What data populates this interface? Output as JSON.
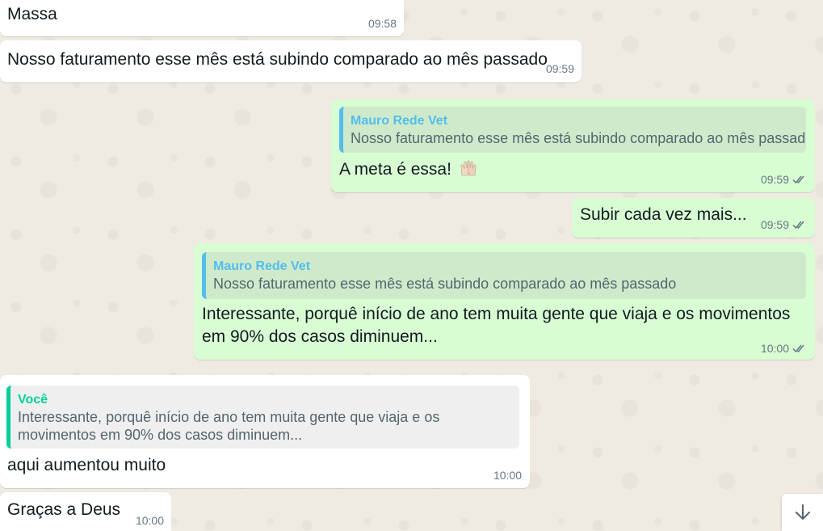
{
  "messages": [
    {
      "text": "Massa",
      "time": "09:58"
    },
    {
      "text": "Nosso faturamento esse mês está subindo comparado ao mês passado",
      "time": "09:59"
    },
    {
      "quote_author": "Mauro Rede Vet",
      "quote_text": "Nosso faturamento esse mês está subindo comparado ao mês passado",
      "text": "A meta é essa!",
      "emoji": "raising-hands-emoji",
      "time": "09:59"
    },
    {
      "text": "Subir cada vez mais...",
      "time": "09:59"
    },
    {
      "quote_author": "Mauro Rede Vet",
      "quote_text": "Nosso faturamento esse mês está subindo comparado ao mês passado",
      "text": "Interessante, porquê início de ano tem muita gente que viaja e os movimentos em 90% dos casos diminuem...",
      "time": "10:00"
    },
    {
      "quote_author": "Você",
      "quote_text": "Interessante, porquê início de ano tem muita gente que viaja e os movimentos em 90% dos casos diminuem...",
      "text": "aqui aumentou muito",
      "time": "10:00"
    },
    {
      "text": "Graças a Deus",
      "time": "10:00"
    }
  ],
  "colors": {
    "chat_background": "#efeae2",
    "incoming_bubble": "#ffffff",
    "outgoing_bubble": "#d9fdd3",
    "read_ticks": "#667781",
    "quote_accent_outgoing": "#53bdeb",
    "quote_accent_incoming": "#06cf9c"
  },
  "icons": {
    "read_receipt": "double-check-icon",
    "scroll_down": "arrow-down-icon"
  }
}
